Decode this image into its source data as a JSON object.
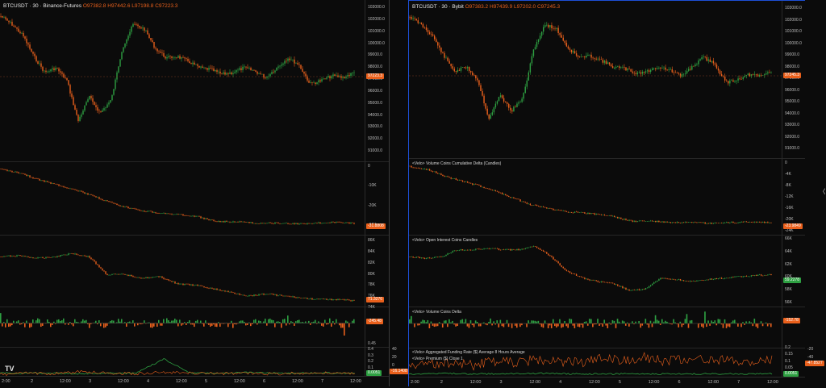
{
  "colors": {
    "up": "#2ea042",
    "down": "#e9601c",
    "bg": "#0b0b0b",
    "grid": "#262626",
    "funding_line": "#e9601c",
    "premium_line": "#2ea042"
  },
  "left": {
    "title": {
      "symbol": "BTCUSDT · 30 · Binance-Futures",
      "o": "O97382.8",
      "h": "H97442.6",
      "l": "L97198.8",
      "c": "C97223.3"
    },
    "price_ticks": [
      "103000.0",
      "102000.0",
      "101000.0",
      "100000.0",
      "99000.0",
      "98000.0",
      "97000.0",
      "96000.0",
      "95000.0",
      "94000.0",
      "93000.0",
      "92000.0",
      "91000.0"
    ],
    "price_badge": "97223.3",
    "cvd_ticks": [
      "0",
      "-10K",
      "-20K",
      "-30K"
    ],
    "cvd_badge": "-31.8808",
    "oi_ticks": [
      "86K",
      "84K",
      "82K",
      "80K",
      "78K",
      "76K",
      "74K"
    ],
    "oi_badge": "71.3276",
    "vd_badge": "-245.48",
    "fund_ticks": [
      "0.45",
      "0.4",
      "0.3",
      "0.2",
      "0.1",
      "0"
    ],
    "fund_badge": "0.0051",
    "prem_ticks": [
      "40",
      "20",
      "0"
    ],
    "prem_badge": "-16.1408",
    "time_labels": [
      "2:00",
      "2",
      "12:00",
      "3",
      "12:00",
      "4",
      "12:00",
      "5",
      "12:00",
      "6",
      "12:00",
      "7",
      "12:00"
    ]
  },
  "right": {
    "title": {
      "symbol": "BTCUSDT · 30 · Bybit",
      "o": "O97383.2",
      "h": "H97439.9",
      "l": "L97202.0",
      "c": "C97245.3"
    },
    "price_ticks": [
      "103000.0",
      "102000.0",
      "101000.0",
      "100000.0",
      "99000.0",
      "98000.0",
      "97000.0",
      "96000.0",
      "95000.0",
      "94000.0",
      "93000.0",
      "92000.0",
      "91000.0"
    ],
    "price_badge": "97245.3",
    "cvd_title": "<Velo> Volume Coins Cumulative Delta (Candles)",
    "cvd_ticks": [
      "0",
      "-4K",
      "-8K",
      "-12K",
      "-16K",
      "-20K",
      "-24K"
    ],
    "cvd_badge": "-23.9849",
    "oi_title": "<Velo> Open Interest Coins Candles",
    "oi_ticks": [
      "66K",
      "64K",
      "62K",
      "60K",
      "58K",
      "56K"
    ],
    "oi_badge": "59.2278",
    "vd_title": "<Velo> Volume Coins Delta",
    "vd_badge": "-152.78",
    "fund_title": "<Velo> Aggregated Funding Rate ($) Average 8 Hours Average",
    "prem_title": "<Velo> Premium ($) Close 1",
    "fund_ticks": [
      "0.2",
      "0.15",
      "0.1",
      "0.05",
      "0"
    ],
    "fund_badge": "0.0051",
    "prem_ticks": [
      "-20",
      "-40"
    ],
    "prem_badge": "-47.8527",
    "time_labels": [
      "2:00",
      "2",
      "12:00",
      "3",
      "12:00",
      "4",
      "12:00",
      "5",
      "12:00",
      "6",
      "12:00",
      "7",
      "12:00"
    ]
  }
}
